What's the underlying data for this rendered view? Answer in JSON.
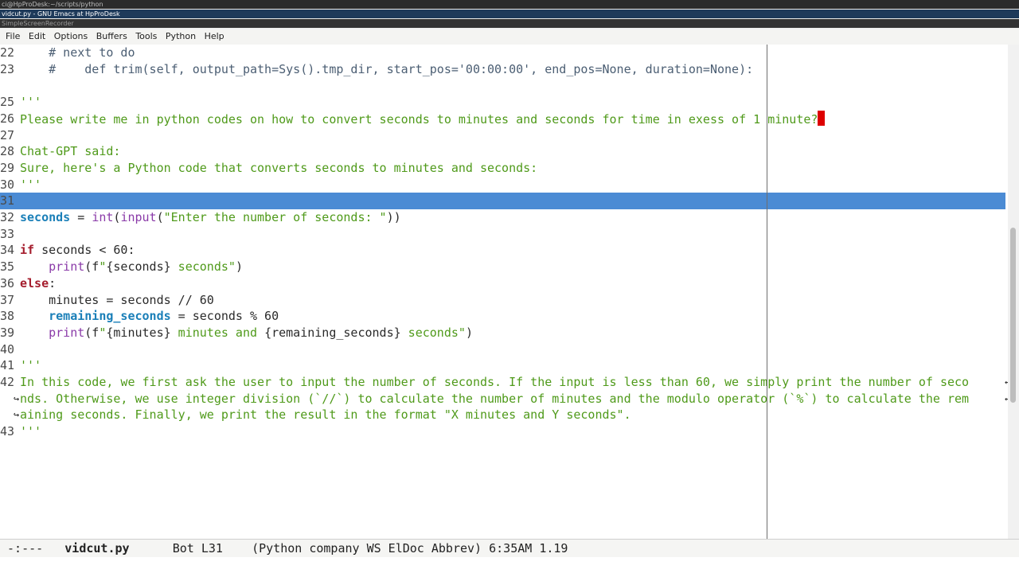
{
  "window_titles": {
    "terminal": "ci@HpProDesk:~/scripts/python",
    "emacs": "vidcut.py - GNU Emacs at HpProDesk",
    "recorder": "SimpleScreenRecorder"
  },
  "menu": [
    "File",
    "Edit",
    "Options",
    "Buffers",
    "Tools",
    "Python",
    "Help"
  ],
  "lines": {
    "n22": "22",
    "n23": "23",
    "n25": "25",
    "n26": "26",
    "n27": "27",
    "n28": "28",
    "n29": "29",
    "n30": "30",
    "n31": "31",
    "n32": "32",
    "n33": "33",
    "n34": "34",
    "n35": "35",
    "n36": "36",
    "n37": "37",
    "n38": "38",
    "n39": "39",
    "n40": "40",
    "n41": "41",
    "n42": "42",
    "n43": "43",
    "l22": "    # next to do",
    "l23": "    #    def trim(self, output_path=Sys().tmp_dir, start_pos='00:00:00', end_pos=None, duration=None):",
    "l25": "'''",
    "l26": "Please write me in python codes on how to convert seconds to minutes and seconds for time in exess of 1 minute?",
    "l28": "Chat-GPT said:",
    "l29": "Sure, here's a Python code that converts seconds to minutes and seconds:",
    "l30": "'''",
    "l32_var": "seconds",
    "l32_eq": " = ",
    "l32_int": "int",
    "l32_p1": "(",
    "l32_input": "input",
    "l32_p2": "(",
    "l32_str": "\"Enter the number of seconds: \"",
    "l32_end": "))",
    "l34_kw": "if",
    "l34_rest": " seconds < 60:",
    "l35_ind": "    ",
    "l35_print": "print",
    "l35_a": "(f",
    "l35_q": "\"",
    "l35_b": "{seconds}",
    "l35_c": " seconds\"",
    "l35_d": ")",
    "l36_kw": "else",
    "l36_rest": ":",
    "l37": "    minutes = seconds // 60",
    "l38_ind": "    ",
    "l38_var": "remaining_seconds",
    "l38_rest": " = seconds % 60",
    "l39_ind": "    ",
    "l39_print": "print",
    "l39_a": "(f",
    "l39_q": "\"",
    "l39_b": "{minutes}",
    "l39_c": " minutes and ",
    "l39_d": "{remaining_seconds}",
    "l39_e": " seconds\"",
    "l39_f": ")",
    "l41": "'''",
    "l42a": "In this code, we first ask the user to input the number of seconds. If the input is less than 60, we simply print the number of seco",
    "l42b": "nds. Otherwise, we use integer division (`//`) to calculate the number of minutes and the modulo operator (`%`) to calculate the rem",
    "l42c": "aining seconds. Finally, we print the result in the format \"X minutes and Y seconds\".",
    "l43": "'''"
  },
  "modeline": {
    "status": "-:---",
    "buffer": "vidcut.py",
    "position": "Bot L31",
    "modes": "(Python company WS ElDoc Abbrev)",
    "time": "6:35AM 1.19"
  },
  "colors": {
    "highlight": "#4b8bd4",
    "string": "#4f9a1a",
    "keyword": "#a51d2d",
    "cursor": "#dd0000"
  }
}
